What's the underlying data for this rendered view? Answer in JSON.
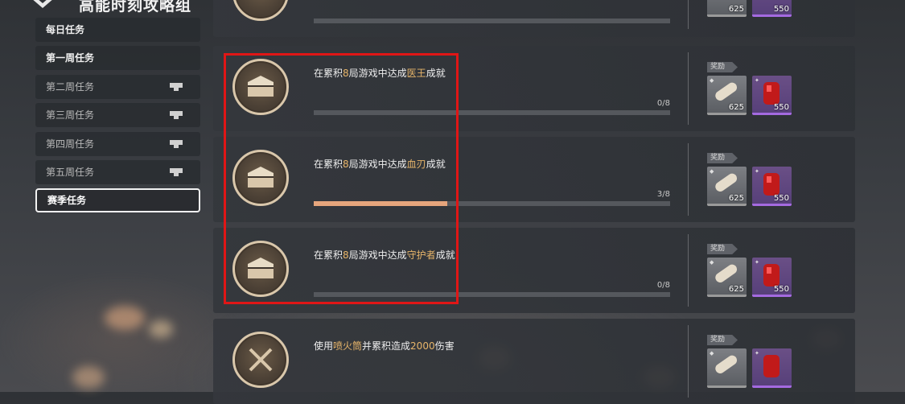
{
  "header": {
    "title": "高能时刻攻略组"
  },
  "sidebar": {
    "items": [
      {
        "label": "每日任务"
      },
      {
        "label": "第一周任务"
      },
      {
        "label": "第二周任务"
      },
      {
        "label": "第三周任务"
      },
      {
        "label": "第四周任务"
      },
      {
        "label": "第五周任务"
      },
      {
        "label": "赛季任务"
      }
    ]
  },
  "tasks": [
    {
      "prefix": "在累积",
      "num": "8",
      "mid": "局游戏中达成",
      "target": "医王",
      "suffix": "成就",
      "progress_text": "0/8",
      "progress": 0,
      "reward_label": "奖励",
      "reward1_count": "625",
      "reward2_count": "550"
    },
    {
      "prefix": "在累积",
      "num": "8",
      "mid": "局游戏中达成",
      "target": "血刃",
      "suffix": "成就",
      "progress_text": "3/8",
      "progress": 0.375,
      "reward_label": "奖励",
      "reward1_count": "625",
      "reward2_count": "550"
    },
    {
      "prefix": "在累积",
      "num": "8",
      "mid": "局游戏中达成",
      "target": "守护者",
      "suffix": "成就",
      "progress_text": "0/8",
      "progress": 0,
      "reward_label": "奖励",
      "reward1_count": "625",
      "reward2_count": "550"
    },
    {
      "prefix": "使用",
      "num": "喷火筒",
      "mid": "并累积造成",
      "target": "2000",
      "suffix": "伤害",
      "reward_label": "奖励"
    }
  ],
  "partial_top_card": {
    "reward1_count": "625",
    "reward2_count": "550"
  },
  "colors": {
    "highlight": "#e7b56a",
    "progress_fill": "#e6a57c",
    "annotation_box": "#e01616"
  }
}
